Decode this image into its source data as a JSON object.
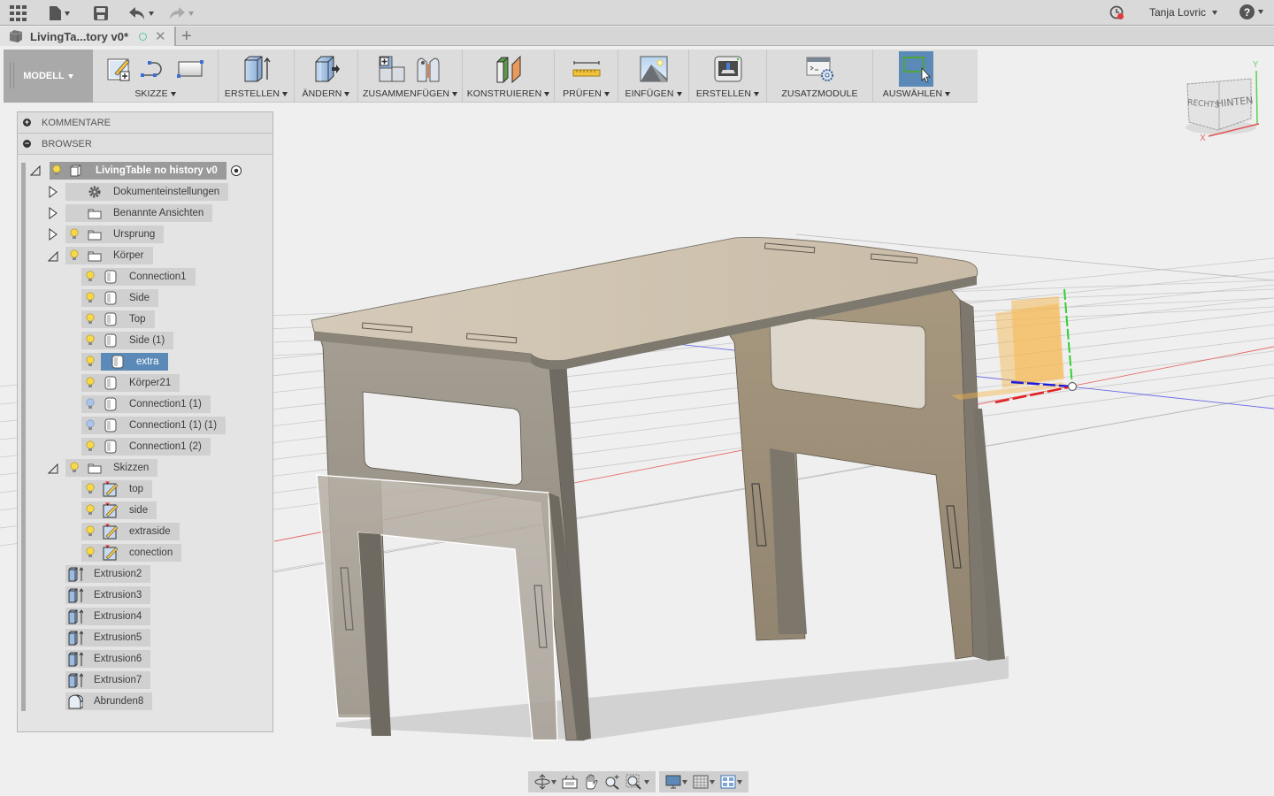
{
  "appbar": {
    "user_name": "Tanja Lovric",
    "icons": [
      "apps-grid-icon",
      "file-menu-icon",
      "save-icon",
      "undo-icon",
      "redo-icon",
      "job-status-icon",
      "help-icon"
    ]
  },
  "tabs": {
    "document_title": "LivingTa...tory v0*",
    "new_tab_label": "+"
  },
  "toolbar": {
    "workspace_label": "MODELL",
    "groups": [
      {
        "label": "SKIZZE",
        "dropdown": true
      },
      {
        "label": "ERSTELLEN",
        "dropdown": true
      },
      {
        "label": "ÄNDERN",
        "dropdown": true
      },
      {
        "label": "ZUSAMMENFÜGEN",
        "dropdown": true
      },
      {
        "label": "KONSTRUIEREN",
        "dropdown": true
      },
      {
        "label": "PRÜFEN",
        "dropdown": true
      },
      {
        "label": "EINFÜGEN",
        "dropdown": true
      },
      {
        "label": "ERSTELLEN",
        "dropdown": true
      },
      {
        "label": "ZUSATZMODULE",
        "dropdown": false
      },
      {
        "label": "AUSWÄHLEN",
        "dropdown": true,
        "active": true
      }
    ]
  },
  "viewcube": {
    "face_right": "RECHTS",
    "face_back": "HINTEN",
    "axis_x": "X",
    "axis_y": "Y"
  },
  "panel": {
    "comments_label": "KOMMENTARE",
    "browser_label": "BROWSER",
    "root": "LivingTable no history v0",
    "items": [
      {
        "label": "Dokumenteinstellungen",
        "level": 1,
        "icon": "gear",
        "expander": "collapsed"
      },
      {
        "label": "Benannte Ansichten",
        "level": 1,
        "icon": "folder",
        "expander": "collapsed"
      },
      {
        "label": "Ursprung",
        "level": 1,
        "icon": "folder",
        "bulb": "on",
        "expander": "collapsed"
      },
      {
        "label": "Körper",
        "level": 1,
        "icon": "folder",
        "bulb": "on",
        "expander": "expanded"
      },
      {
        "label": "Connection1",
        "level": 2,
        "icon": "body",
        "bulb": "on"
      },
      {
        "label": "Side",
        "level": 2,
        "icon": "body",
        "bulb": "on"
      },
      {
        "label": "Top",
        "level": 2,
        "icon": "body",
        "bulb": "on"
      },
      {
        "label": "Side (1)",
        "level": 2,
        "icon": "body",
        "bulb": "on"
      },
      {
        "label": "extra",
        "level": 2,
        "icon": "body",
        "bulb": "on",
        "selected": true
      },
      {
        "label": "Körper21",
        "level": 2,
        "icon": "body",
        "bulb": "on"
      },
      {
        "label": "Connection1 (1)",
        "level": 2,
        "icon": "body",
        "bulb": "off"
      },
      {
        "label": "Connection1 (1) (1)",
        "level": 2,
        "icon": "body",
        "bulb": "off"
      },
      {
        "label": "Connection1 (2)",
        "level": 2,
        "icon": "body",
        "bulb": "on"
      },
      {
        "label": "Skizzen",
        "level": 1,
        "icon": "folder",
        "bulb": "on",
        "expander": "expanded"
      },
      {
        "label": "top",
        "level": 2,
        "icon": "sketch",
        "bulb": "on"
      },
      {
        "label": "side",
        "level": 2,
        "icon": "sketch",
        "bulb": "on"
      },
      {
        "label": "extraside",
        "level": 2,
        "icon": "sketch",
        "bulb": "on"
      },
      {
        "label": "conection",
        "level": 2,
        "icon": "sketch",
        "bulb": "on"
      },
      {
        "label": "Extrusion2",
        "level": 1,
        "icon": "extrude"
      },
      {
        "label": "Extrusion3",
        "level": 1,
        "icon": "extrude"
      },
      {
        "label": "Extrusion4",
        "level": 1,
        "icon": "extrude"
      },
      {
        "label": "Extrusion5",
        "level": 1,
        "icon": "extrude"
      },
      {
        "label": "Extrusion6",
        "level": 1,
        "icon": "extrude"
      },
      {
        "label": "Extrusion7",
        "level": 1,
        "icon": "extrude"
      },
      {
        "label": "Abrunden8",
        "level": 1,
        "icon": "fillet"
      }
    ]
  },
  "colors": {
    "accent": "#5b8ab8",
    "bulb_on": "#f5d94a",
    "bulb_off": "#aac4ea",
    "status_dot": "#5cc4a9",
    "axis_x": "#e23a3a",
    "axis_y": "#3ad23a",
    "axis_z": "#2a2ae0",
    "plane": "#f6b54a"
  },
  "navbar": {
    "icons": [
      "orbit-icon",
      "look-at-icon",
      "pan-icon",
      "zoom-icon",
      "fit-icon",
      "display-settings-icon",
      "grid-settings-icon",
      "viewports-icon"
    ]
  }
}
